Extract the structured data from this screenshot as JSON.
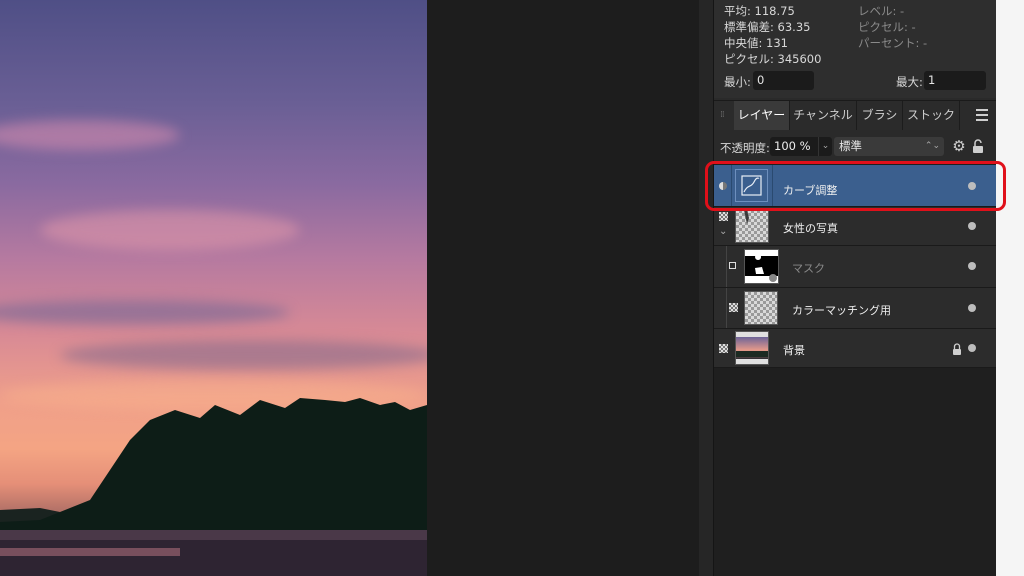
{
  "histogram": {
    "mean": "平均: 118.75",
    "std_dev": "標準偏差: 63.35",
    "median": "中央値: 131",
    "pixels": "ピクセル: 345600",
    "level": "レベル: -",
    "pixel_right": "ピクセル: -",
    "percent": "パーセント: -",
    "min_label": "最小:",
    "min_value": "0",
    "max_label": "最大:",
    "max_value": "1"
  },
  "tabs": [
    {
      "label": "レイヤー",
      "active": true
    },
    {
      "label": "チャンネル"
    },
    {
      "label": "ブラシ"
    },
    {
      "label": "ストック"
    }
  ],
  "opacity": {
    "label": "不透明度:",
    "value": "100 %",
    "blend_mode": "標準"
  },
  "layers": [
    {
      "name": "カーブ調整",
      "selected": true,
      "thumb_icon": "curves-icon"
    },
    {
      "name": "女性の写真",
      "thumb_icon": "photo-thumb"
    },
    {
      "name": "マスク",
      "dim": true,
      "thumb_icon": "mask-thumb"
    },
    {
      "name": "カラーマッチング用",
      "thumb_icon": "transparent-thumb"
    },
    {
      "name": "背景",
      "locked": true,
      "thumb_icon": "sunset-thumb"
    }
  ],
  "colors": {
    "selection": "#3b5f8e",
    "highlight": "#e0101a"
  }
}
